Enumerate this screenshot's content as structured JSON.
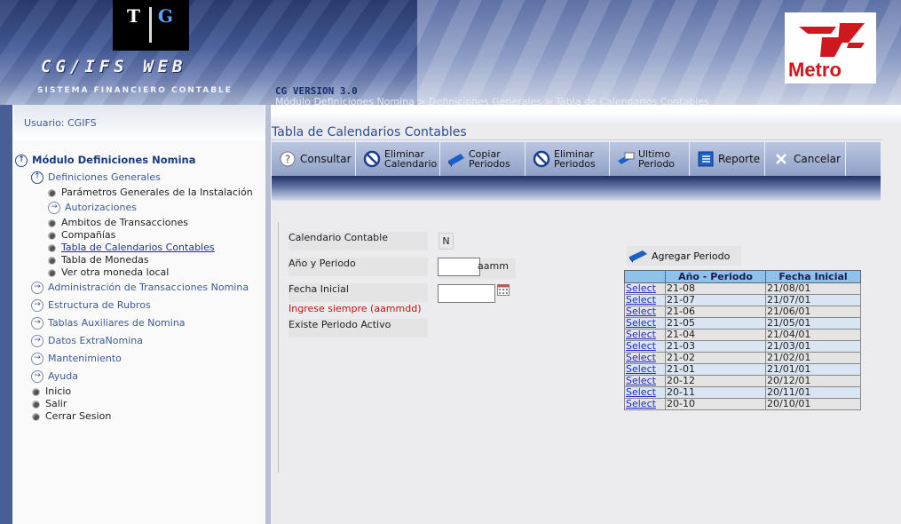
{
  "header": {
    "logo_letters": [
      "T",
      "G"
    ],
    "app_title": "CG/IFS  WEB",
    "app_subtitle": "SISTEMA FINANCIERO CONTABLE",
    "brand": "Metro",
    "version": "CG VERSION 3.0",
    "breadcrumb": "Módulo Definiciones Nomina > Definiciones Generales > Tabla de Calendarios Contables"
  },
  "sidebar": {
    "user_label": "Usuario: CGIFS",
    "module_title": "Módulo Definiciones Nomina",
    "groups": [
      {
        "label": "Definiciones Generales",
        "expanded": true
      },
      {
        "label": "Administración de Transacciones Nomina"
      },
      {
        "label": "Estructura de Rubros"
      },
      {
        "label": "Tablas Auxiliares de Nomina"
      },
      {
        "label": "Datos ExtraNomina"
      },
      {
        "label": "Mantenimiento"
      },
      {
        "label": "Ayuda"
      }
    ],
    "sub_items": [
      "Parámetros Generales de la Instalación",
      "Autorizaciones",
      "Ambitos de Transacciones",
      "Compañías",
      "Tabla de Calendarios Contables",
      "Tabla de Monedas",
      "Ver otra moneda local"
    ],
    "bottom_items": [
      "Inicio",
      "Salir",
      "Cerrar Sesion"
    ]
  },
  "page_title": "Tabla de Calendarios Contables",
  "toolbar": {
    "consultar": "Consultar",
    "eliminar_calendario": [
      "Eliminar",
      "Calendario"
    ],
    "copiar_periodos": [
      "Copiar",
      "Periodos"
    ],
    "eliminar_periodos": [
      "Eliminar",
      "Periodos"
    ],
    "ultimo_periodo": [
      "Ultimo",
      "Periodo"
    ],
    "reporte": "Reporte",
    "cancelar": "Cancelar"
  },
  "form": {
    "calendario_label": "Calendario Contable",
    "calendario_value": "N",
    "anio_periodo_label": "Año y Periodo",
    "anio_periodo_value": "",
    "anio_periodo_suffix": "aamm",
    "fecha_inicial_label": "Fecha Inicial",
    "fecha_inicial_value": "",
    "hint": "Ingrese siempre (aammdd)",
    "existe_label": "Existe Periodo Activo"
  },
  "periods": {
    "add_label": "Agregar Periodo",
    "columns": [
      "",
      "Año - Periodo",
      "Fecha Inicial"
    ],
    "select_label": "Select",
    "rows": [
      {
        "periodo": "21-08",
        "fecha": "21/08/01"
      },
      {
        "periodo": "21-07",
        "fecha": "21/07/01"
      },
      {
        "periodo": "21-06",
        "fecha": "21/06/01"
      },
      {
        "periodo": "21-05",
        "fecha": "21/05/01"
      },
      {
        "periodo": "21-04",
        "fecha": "21/04/01"
      },
      {
        "periodo": "21-03",
        "fecha": "21/03/01"
      },
      {
        "periodo": "21-02",
        "fecha": "21/02/01"
      },
      {
        "periodo": "21-01",
        "fecha": "21/01/01"
      },
      {
        "periodo": "20-12",
        "fecha": "20/12/01"
      },
      {
        "periodo": "20-11",
        "fecha": "20/11/01"
      },
      {
        "periodo": "20-10",
        "fecha": "20/10/01"
      }
    ]
  },
  "colors": {
    "brand_red": "#d0161e",
    "header_blue": "#2b3e74",
    "hint_red": "#c01212",
    "grid_header": "#8fc2ea"
  }
}
